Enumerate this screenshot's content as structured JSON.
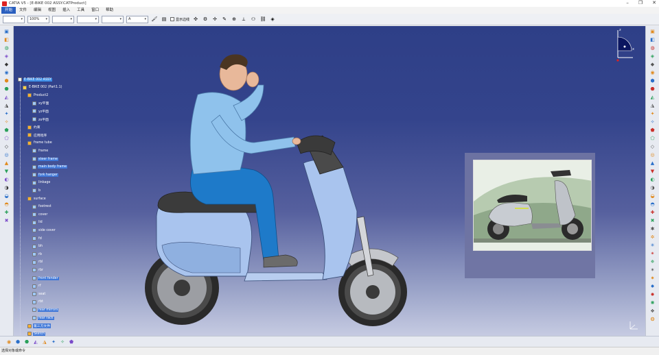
{
  "window": {
    "title": "CATIA V5 - [E-BIKE 002 ASSY.CATProduct]",
    "minimize": "–",
    "restore": "❐",
    "close": "✕"
  },
  "menu": {
    "items": [
      {
        "label": "开始",
        "active": true
      },
      {
        "label": "文件"
      },
      {
        "label": "编辑"
      },
      {
        "label": "视图"
      },
      {
        "label": "插入"
      },
      {
        "label": "工具"
      },
      {
        "label": "窗口"
      },
      {
        "label": "帮助"
      }
    ]
  },
  "toolbar": {
    "combo1": "",
    "zoom": "100%",
    "combo3": "",
    "combo4": "",
    "combo5": "",
    "combo6": "A",
    "checkbox_label": "显示边线"
  },
  "tree": {
    "root": "E-BIKE 002 ASSY",
    "nodes": [
      {
        "label": "E-BIKE 002 ASSY",
        "level": 0,
        "selected": true
      },
      {
        "label": "E-BIKE 002 (Part1.1)",
        "level": 1
      },
      {
        "label": "Product2",
        "level": 2
      },
      {
        "label": "xy平面",
        "level": 3
      },
      {
        "label": "yz平面",
        "level": 3
      },
      {
        "label": "zx平面",
        "level": 3
      },
      {
        "label": "约束",
        "level": 2
      },
      {
        "label": "应用程序",
        "level": 2
      },
      {
        "label": "frame tube",
        "level": 2
      },
      {
        "label": "frame",
        "level": 3
      },
      {
        "label": "steer frame",
        "level": 3,
        "hl": true
      },
      {
        "label": "main body frame",
        "level": 3,
        "hl": true
      },
      {
        "label": "fork hanger",
        "level": 3,
        "hl": true
      },
      {
        "label": "linkage",
        "level": 3
      },
      {
        "label": "b",
        "level": 3
      },
      {
        "label": "surface",
        "level": 2
      },
      {
        "label": "footrest",
        "level": 3
      },
      {
        "label": "cover",
        "level": 3
      },
      {
        "label": "lid",
        "level": 3
      },
      {
        "label": "side cover",
        "level": 3
      },
      {
        "label": "fd",
        "level": 3
      },
      {
        "label": "bh",
        "level": 3
      },
      {
        "label": "rb",
        "level": 3
      },
      {
        "label": "rbl",
        "level": 3
      },
      {
        "label": "rbr",
        "level": 3
      },
      {
        "label": "front fender",
        "level": 3,
        "hl": true
      },
      {
        "label": "rf",
        "level": 3
      },
      {
        "label": "seat",
        "level": 3
      },
      {
        "label": "rbt",
        "level": 3
      },
      {
        "label": "rear mirrors",
        "level": 3,
        "hl": true
      },
      {
        "label": "rear rack",
        "level": 3,
        "hl": true
      },
      {
        "label": "第三方文件",
        "level": 2,
        "hl": true
      },
      {
        "label": "Sketch",
        "level": 2,
        "hl": true
      }
    ]
  },
  "compass": {
    "z_label": "z",
    "x_label": "x"
  },
  "status": {
    "text": "选择对象或命令"
  },
  "colors": {
    "viewport_top": "#2e3f87",
    "viewport_bottom": "#c6cbe2",
    "scooter_body": "#a9c4ee",
    "rider_shirt": "#8fc2ec",
    "rider_pants": "#1e7ac9",
    "selection": "#3b8ee8"
  },
  "icons": {
    "left_toolbar": [
      "select-icon",
      "sketch-icon",
      "pad-icon",
      "pocket-icon",
      "shaft-icon",
      "groove-icon",
      "hole-icon",
      "rib-icon",
      "slot-icon",
      "stiffener-icon",
      "loft-icon",
      "shell-icon",
      "thickness-icon",
      "draft-icon",
      "fillet-icon",
      "chamfer-icon",
      "mirror-icon",
      "pattern-icon",
      "scale-icon",
      "measure-icon",
      "boolean-icon",
      "axis-icon",
      "plane-icon",
      "point-icon"
    ],
    "right_toolbar": [
      "fly-icon",
      "fit-all-icon",
      "pan-icon",
      "rotate-icon",
      "zoom-in-icon",
      "zoom-out-icon",
      "normal-view-icon",
      "views-icon",
      "shading-icon",
      "hide-show-icon",
      "swap-space-icon",
      "sketcher-icon",
      "pad-icon",
      "pocket-icon",
      "hole-icon",
      "fillet-icon",
      "draft-icon",
      "shell-icon",
      "thread-icon",
      "split-icon",
      "translate-icon",
      "rotate-part-icon",
      "symmetry-icon",
      "scale-icon",
      "render-icon",
      "light-icon",
      "material-icon",
      "apply-material-icon",
      "analysis-icon",
      "section-icon",
      "clash-icon",
      "snap-icon",
      "axis-icon",
      "plane-icon",
      "point-icon",
      "line-icon"
    ],
    "bottom_toolbar": [
      "constraint-icon",
      "fix-icon",
      "coincidence-icon",
      "contact-icon",
      "offset-icon",
      "angle-icon",
      "update-icon",
      "grid-icon"
    ]
  }
}
